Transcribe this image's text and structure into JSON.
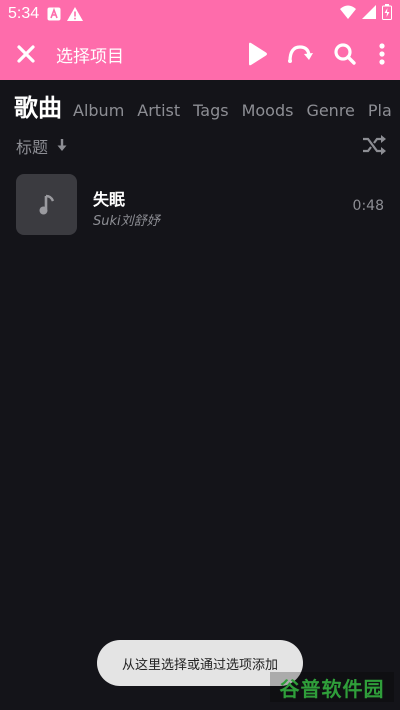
{
  "status": {
    "time": "5:34"
  },
  "action_bar": {
    "title": "选择项目"
  },
  "tabs": [
    {
      "label": "歌曲",
      "active": true
    },
    {
      "label": "Album",
      "active": false
    },
    {
      "label": "Artist",
      "active": false
    },
    {
      "label": "Tags",
      "active": false
    },
    {
      "label": "Moods",
      "active": false
    },
    {
      "label": "Genre",
      "active": false
    },
    {
      "label": "Pla",
      "active": false
    }
  ],
  "sort": {
    "label": "标题"
  },
  "songs": [
    {
      "title": "失眠",
      "artist": "Suki刘舒妤",
      "duration": "0:48"
    }
  ],
  "toast": {
    "text": "从这里选择或通过选项添加"
  },
  "watermark": {
    "text": "谷普软件园"
  },
  "colors": {
    "accent": "#fe6cab",
    "background": "#141419",
    "muted_text": "#8d8e94"
  }
}
